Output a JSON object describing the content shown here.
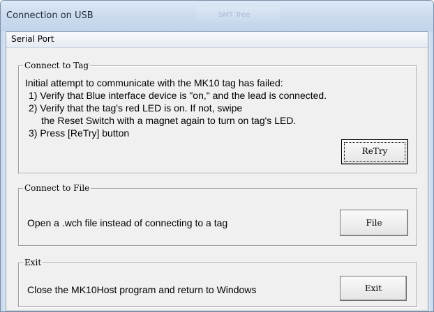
{
  "window": {
    "title": "Connection on USB",
    "background_tab_text": "SMT Tree"
  },
  "menubar": {
    "items": [
      {
        "label": "Serial Port"
      }
    ]
  },
  "connect_to_tag": {
    "legend": "Connect to Tag",
    "lines": [
      "Initial attempt to communicate with the MK10 tag has failed:",
      "1) Verify that Blue interface device is \"on,\" and the lead is connected.",
      "2) Verify that the tag's red LED is on.  If not, swipe",
      "the Reset Switch with a magnet again to turn on tag's LED.",
      "3) Press [ReTry] button"
    ],
    "button_label": "ReTry"
  },
  "connect_to_file": {
    "legend": "Connect to File",
    "description": "Open a .wch file instead of connecting to a tag",
    "button_label": "File"
  },
  "exit": {
    "legend": "Exit",
    "description": "Close the MK10Host program and return to Windows",
    "button_label": "Exit"
  },
  "colors": {
    "frame": "#c2d4ea",
    "dialog_background": "#f0f0f0"
  }
}
